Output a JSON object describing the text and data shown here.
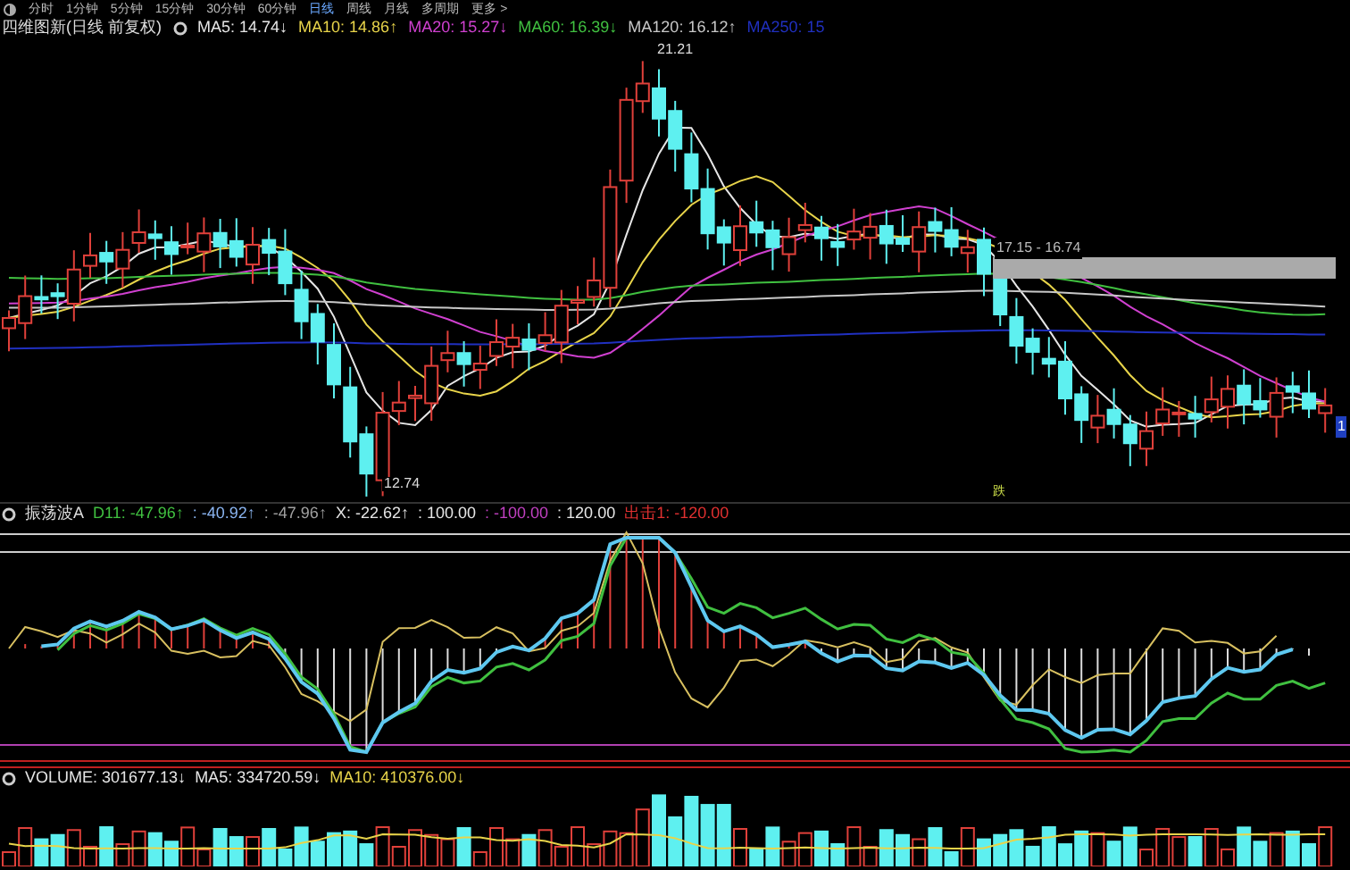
{
  "toolbar": {
    "periods": [
      {
        "label": "分时",
        "selected": false
      },
      {
        "label": "1分钟",
        "selected": false
      },
      {
        "label": "5分钟",
        "selected": false
      },
      {
        "label": "15分钟",
        "selected": false
      },
      {
        "label": "30分钟",
        "selected": false
      },
      {
        "label": "60分钟",
        "selected": false
      },
      {
        "label": "日线",
        "selected": true
      },
      {
        "label": "周线",
        "selected": false
      },
      {
        "label": "月线",
        "selected": false
      },
      {
        "label": "多周期",
        "selected": false
      },
      {
        "label": "更多 >",
        "selected": false
      }
    ]
  },
  "price_panel": {
    "title": "四维图新(日线 前复权)",
    "indicators": [
      {
        "text": "MA5: 14.74↓",
        "color": "#e6e6e6"
      },
      {
        "text": "MA10: 14.86↑",
        "color": "#e8d44a"
      },
      {
        "text": "MA20: 15.27↓",
        "color": "#d040d0"
      },
      {
        "text": "MA60: 16.39↓",
        "color": "#40c040"
      },
      {
        "text": "MA120: 16.12↑",
        "color": "#c8c8c8"
      },
      {
        "text": "MA250: 15",
        "color": "#2030c0"
      }
    ],
    "high_label": "21.21",
    "low_label": "12.74",
    "range_label": "17.15 - 16.74",
    "signal_badge": "跌",
    "axis_badge": "1"
  },
  "oscillator_panel": {
    "title": "振荡波A",
    "indicators": [
      {
        "text": "D11: -47.96↑",
        "color": "#40c040"
      },
      {
        "text": ": -40.92↑",
        "color": "#8ab4f0"
      },
      {
        "text": ": -47.96↑",
        "color": "#a0a0a0"
      },
      {
        "text": "X: -22.62↑",
        "color": "#e6e6e6"
      },
      {
        "text": ": 100.00",
        "color": "#e6e6e6"
      },
      {
        "text": ": -100.00",
        "color": "#c040c0"
      },
      {
        "text": ": 120.00",
        "color": "#e6e6e6"
      },
      {
        "text": "出击1: -120.00",
        "color": "#e03030"
      }
    ]
  },
  "volume_panel": {
    "indicators": [
      {
        "text": "VOLUME: 301677.13↓",
        "color": "#e6e6e6"
      },
      {
        "text": "MA5: 334720.59↓",
        "color": "#e6e6e6"
      },
      {
        "text": "MA10: 410376.00↓",
        "color": "#e8d44a"
      }
    ]
  }
}
